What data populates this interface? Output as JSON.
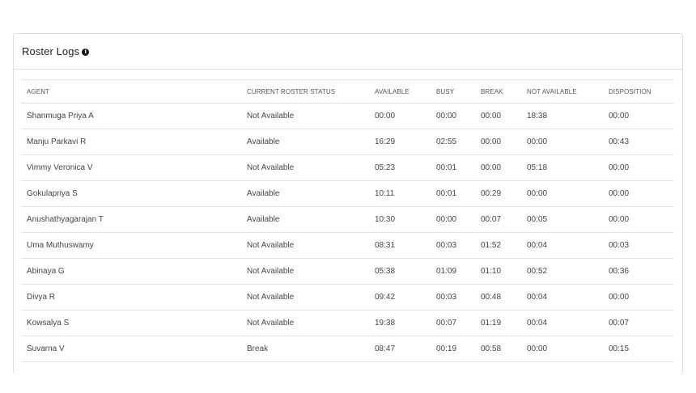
{
  "card": {
    "title": "Roster Logs",
    "info_icon": "info-icon"
  },
  "table": {
    "headers": {
      "agent": "AGENT",
      "status": "CURRENT ROSTER STATUS",
      "available": "AVAILABLE",
      "busy": "BUSY",
      "break": "BREAK",
      "not_available": "NOT AVAILABLE",
      "disposition": "DISPOSITION"
    },
    "rows": [
      {
        "agent": "Shanmuga Priya A",
        "status": "Not Available",
        "available": "00:00",
        "busy": "00:00",
        "break": "00:00",
        "not_available": "18:38",
        "disposition": "00:00"
      },
      {
        "agent": "Manju Parkavi R",
        "status": "Available",
        "available": "16:29",
        "busy": "02:55",
        "break": "00:00",
        "not_available": "00:00",
        "disposition": "00:43"
      },
      {
        "agent": "Vimmy Veronica V",
        "status": "Not Available",
        "available": "05:23",
        "busy": "00:01",
        "break": "00:00",
        "not_available": "05:18",
        "disposition": "00:00"
      },
      {
        "agent": "Gokulapriya S",
        "status": "Available",
        "available": "10:11",
        "busy": "00:01",
        "break": "00:29",
        "not_available": "00:00",
        "disposition": "00:00"
      },
      {
        "agent": "Anushathyagarajan T",
        "status": "Available",
        "available": "10:30",
        "busy": "00:00",
        "break": "00:07",
        "not_available": "00:05",
        "disposition": "00:00"
      },
      {
        "agent": "Uma Muthuswamy",
        "status": "Not Available",
        "available": "08:31",
        "busy": "00:03",
        "break": "01:52",
        "not_available": "00:04",
        "disposition": "00:03"
      },
      {
        "agent": "Abinaya G",
        "status": "Not Available",
        "available": "05:38",
        "busy": "01:09",
        "break": "01:10",
        "not_available": "00:52",
        "disposition": "00:36"
      },
      {
        "agent": "Divya R",
        "status": "Not Available",
        "available": "09:42",
        "busy": "00:03",
        "break": "00:48",
        "not_available": "00:04",
        "disposition": "00:00"
      },
      {
        "agent": "Kowsalya S",
        "status": "Not Available",
        "available": "19:38",
        "busy": "00:07",
        "break": "01:19",
        "not_available": "00:04",
        "disposition": "00:07"
      },
      {
        "agent": "Suvarna V",
        "status": "Break",
        "available": "08:47",
        "busy": "00:19",
        "break": "00:58",
        "not_available": "00:00",
        "disposition": "00:15"
      }
    ]
  }
}
